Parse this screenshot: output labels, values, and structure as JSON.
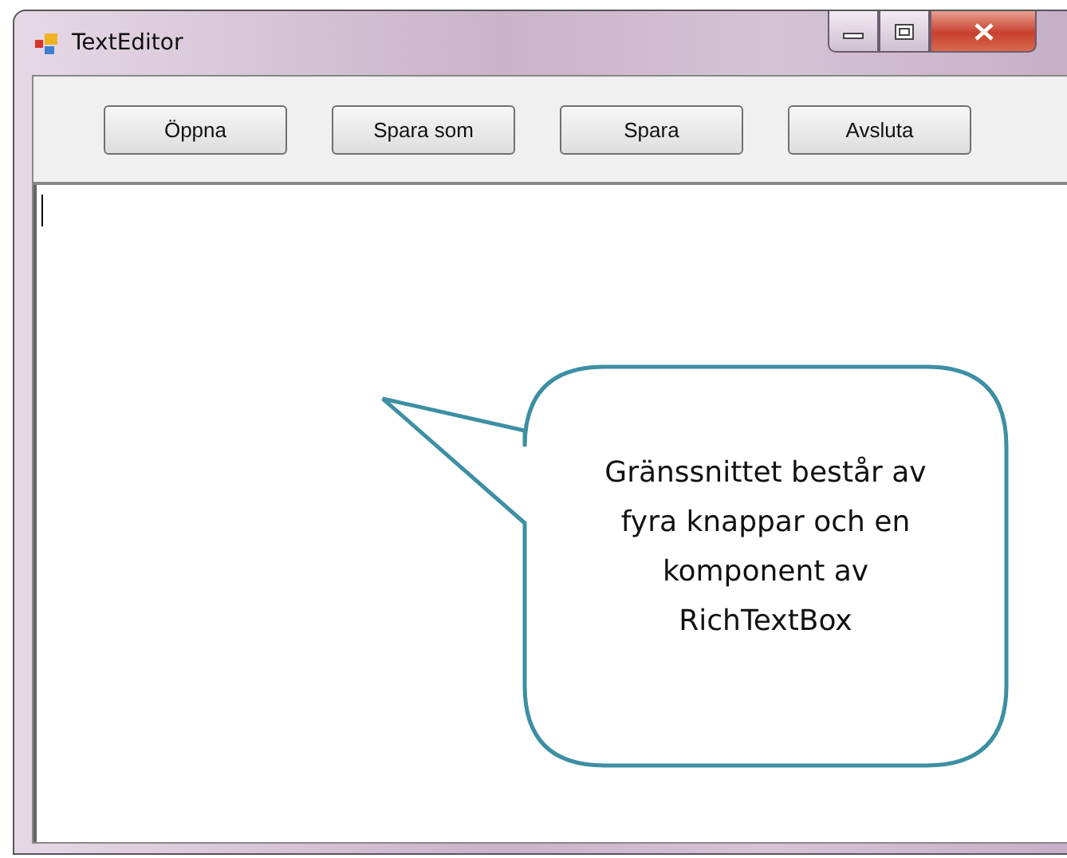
{
  "window": {
    "title": "TextEditor"
  },
  "toolbar": {
    "buttons": [
      {
        "label": "Öppna"
      },
      {
        "label": "Spara som"
      },
      {
        "label": "Spara"
      },
      {
        "label": "Avsluta"
      }
    ]
  },
  "callout": {
    "text": "Gränssnittet består av\nfyra knappar och en\nkomponent av\nRichTextBox"
  }
}
